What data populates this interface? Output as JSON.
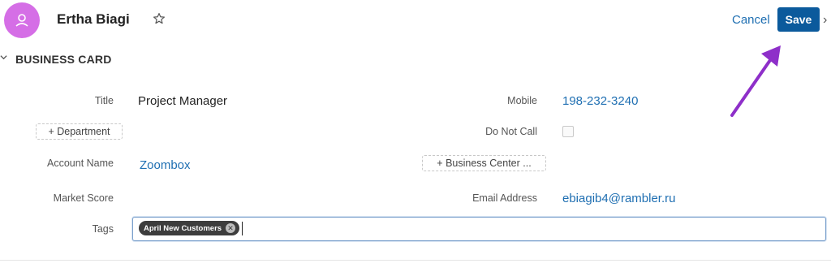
{
  "header": {
    "record_name": "Ertha Biagi",
    "cancel_label": "Cancel",
    "save_label": "Save",
    "avatar_color": "#d56ee6",
    "save_color": "#0b5a9c",
    "link_color": "#1f6fb2"
  },
  "section": {
    "title": "BUSINESS CARD"
  },
  "fields": {
    "title_label": "Title",
    "title_value": "Project Manager",
    "department_button": "+ Department",
    "account_name_label": "Account Name",
    "account_name_value": "Zoombox",
    "market_score_label": "Market Score",
    "tags_label": "Tags",
    "mobile_label": "Mobile",
    "mobile_value": "198-232-3240",
    "do_not_call_label": "Do Not Call",
    "business_center_button": "+ Business Center ...",
    "email_label": "Email Address",
    "email_value": "ebiagib4@rambler.ru"
  },
  "tags": {
    "items": [
      "April New Customers"
    ]
  },
  "icons": {
    "avatar": "user-icon",
    "favorite": "star-icon",
    "section": "chevron-down-icon",
    "tag_remove": "close-circle-icon",
    "next": "chevron-right-icon"
  }
}
